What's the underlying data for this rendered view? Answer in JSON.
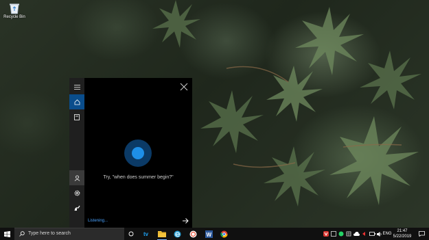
{
  "desktop": {
    "recycle_bin_label": "Recycle Bin"
  },
  "cortana": {
    "hint_text": "Try, \"when does summer begin?\"",
    "status_text": "Listening...",
    "accent_color": "#1e8fe8",
    "rail_items": [
      "menu-icon",
      "home-icon",
      "notebook-icon",
      "account-icon",
      "settings-icon",
      "feedback-icon"
    ]
  },
  "taskbar": {
    "search_placeholder": "Type here to search",
    "language": "ENG",
    "time": "21:47",
    "date": "5/22/2019",
    "pinned_apps": [
      "cortana-icon",
      "task-view-icon",
      "tv-app-icon",
      "file-explorer-icon",
      "edge-icon",
      "scratch-icon",
      "word-icon",
      "chrome-icon"
    ]
  }
}
